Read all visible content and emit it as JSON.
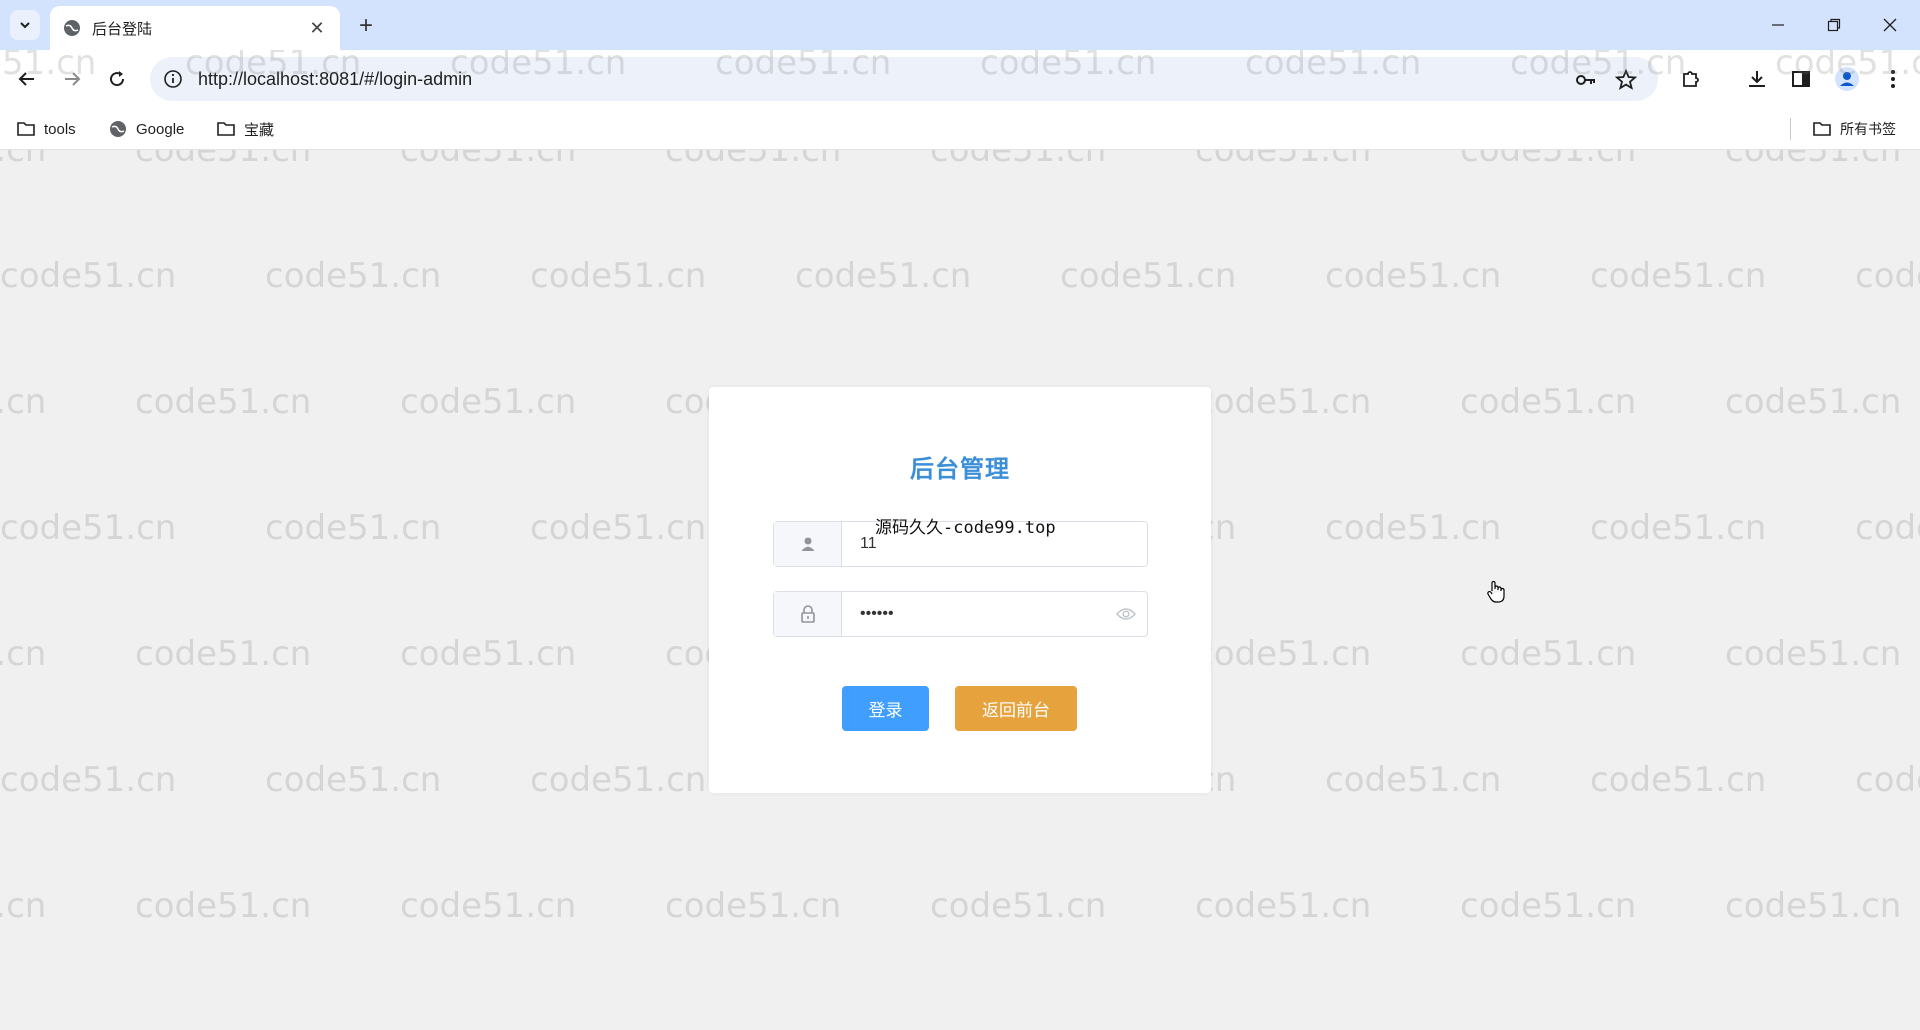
{
  "browser": {
    "tab_title": "后台登陆",
    "url": "http://localhost:8081/#/login-admin",
    "bookmarks": [
      {
        "label": "tools",
        "icon": "folder-icon"
      },
      {
        "label": "Google",
        "icon": "globe-icon"
      },
      {
        "label": "宝藏",
        "icon": "folder-icon"
      }
    ],
    "all_bookmarks_label": "所有书签"
  },
  "watermark": {
    "text": "code51.cn"
  },
  "login": {
    "title": "后台管理",
    "notice": "源码久久-code99.top",
    "username_value": "11",
    "password_value": "••••••",
    "login_button": "登录",
    "back_button": "返回前台"
  },
  "colors": {
    "title": "#3b8fd8",
    "login_button": "#409eff",
    "back_button": "#e6a23c",
    "tab_strip": "#d3e3fd"
  }
}
